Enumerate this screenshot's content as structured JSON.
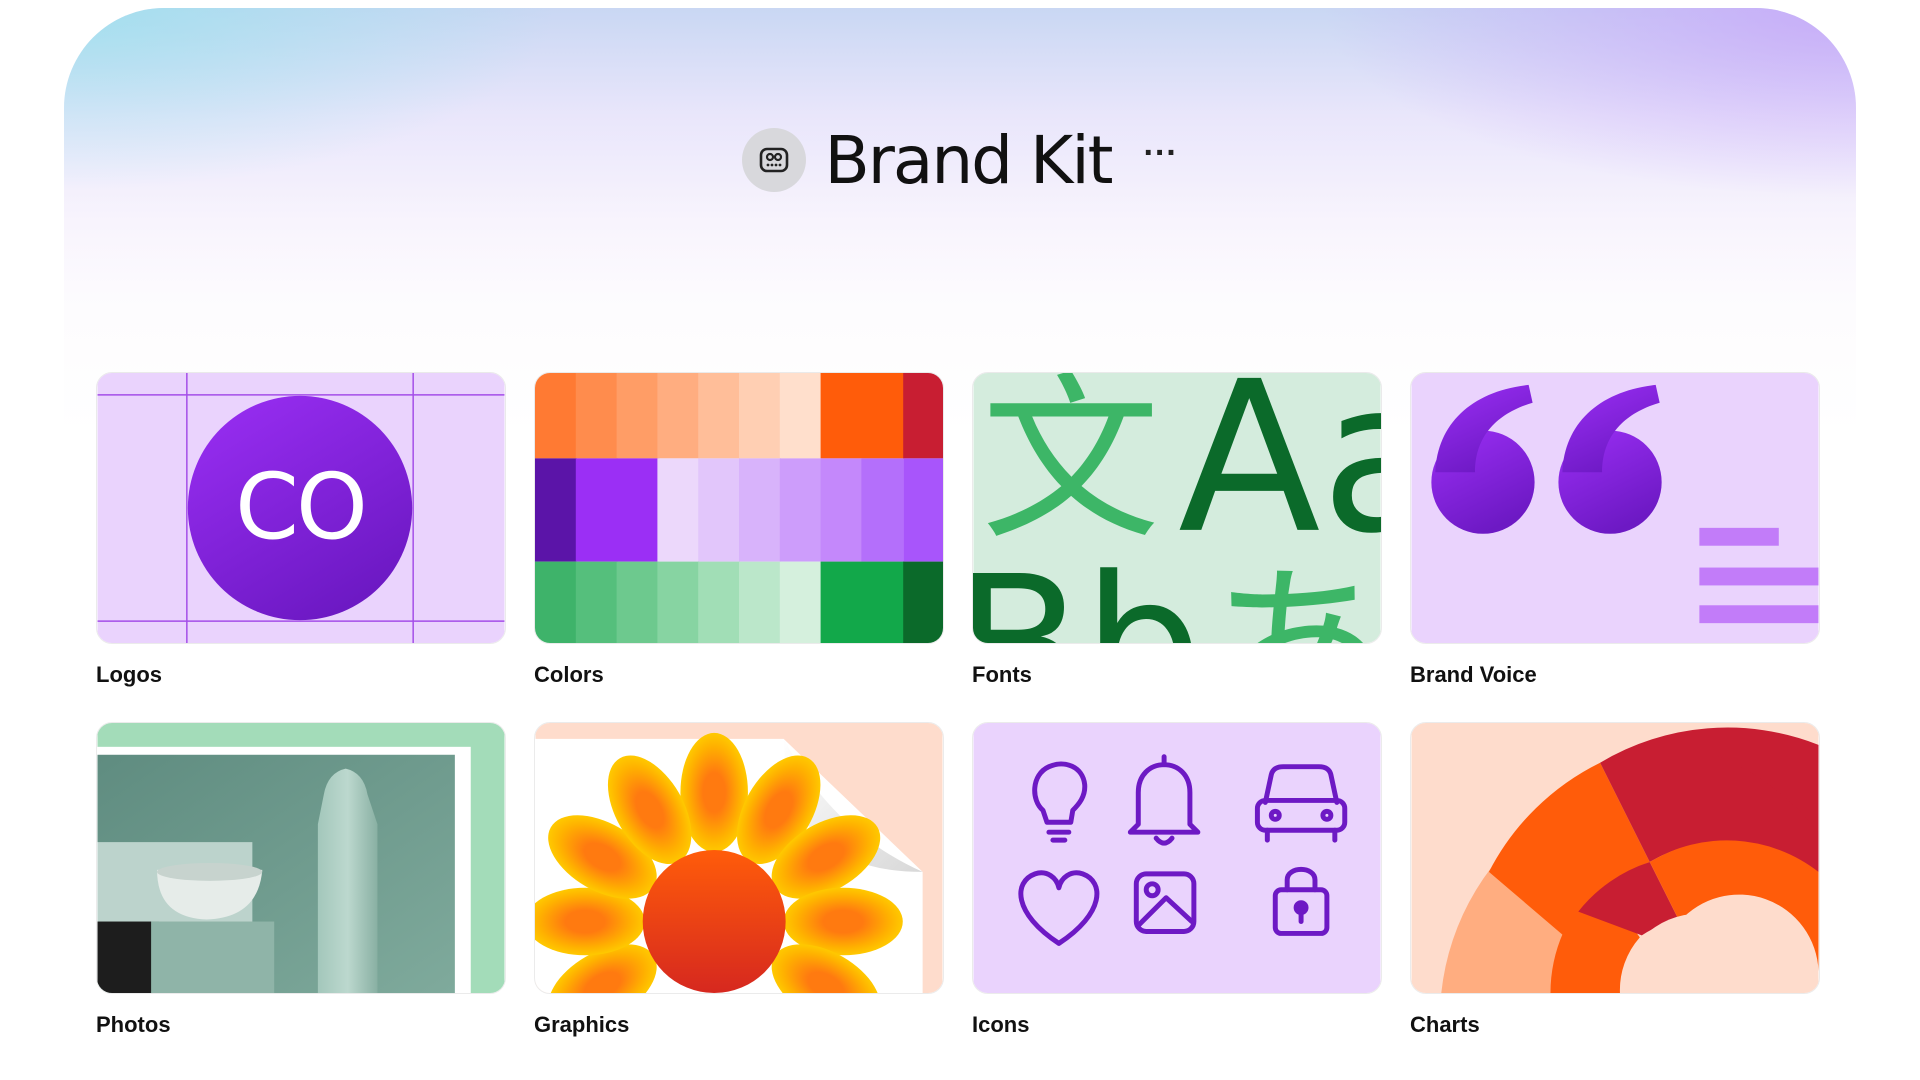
{
  "header": {
    "title": "Brand Kit",
    "more": "···",
    "icon": "brand-kit-icon"
  },
  "tiles": [
    {
      "label": "Logos",
      "logo_text": "CO"
    },
    {
      "label": "Colors"
    },
    {
      "label": "Fonts",
      "glyph_cjk": "文",
      "glyph_latin": "Aa",
      "glyph_latin2": "Bb",
      "glyph_kana": "あ"
    },
    {
      "label": "Brand Voice"
    },
    {
      "label": "Photos"
    },
    {
      "label": "Graphics"
    },
    {
      "label": "Icons",
      "icons": [
        "lightbulb-icon",
        "bell-icon",
        "car-icon",
        "heart-icon",
        "image-icon",
        "lock-icon"
      ]
    },
    {
      "label": "Charts"
    }
  ],
  "colors": {
    "purple": "#8b28e8",
    "orange": "#ff5c0a",
    "green": "#12a84a",
    "red": "#c81e32",
    "lavender": "#ead3fd"
  }
}
